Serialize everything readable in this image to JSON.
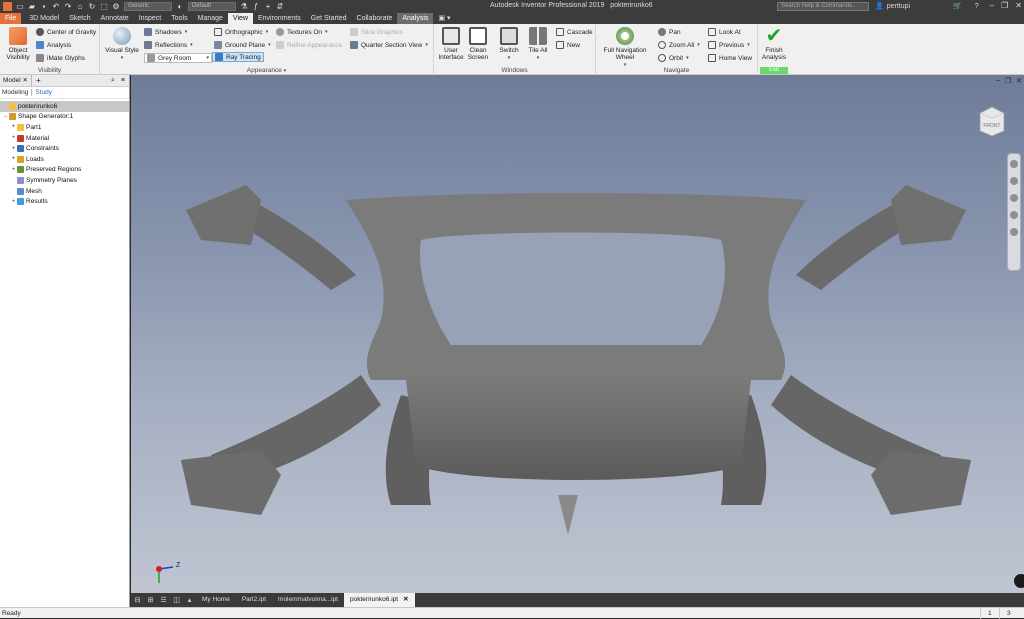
{
  "window": {
    "title": "Autodesk Inventor Professional 2019",
    "document": "pokterirunko6",
    "material_combo": "Generic",
    "appearance_combo": "Default",
    "help_search_placeholder": "Search Help & Commands...",
    "user": "perttupi"
  },
  "ribbon_tabs": [
    "File",
    "3D Model",
    "Sketch",
    "Annotate",
    "Inspect",
    "Tools",
    "Manage",
    "View",
    "Environments",
    "Get Started",
    "Collaborate",
    "Analysis"
  ],
  "active_tab": "View",
  "ribbon": {
    "visibility": {
      "label": "Visibility",
      "object_visibility": "Object Visibility",
      "center_of_gravity": "Center of Gravity",
      "analysis": "Analysis",
      "imate_glyphs": "iMate Glyphs"
    },
    "appearance": {
      "label": "Appearance",
      "visual_style": "Visual Style",
      "shadows": "Shadows",
      "reflections": "Reflections",
      "grey_room": "Grey Room",
      "orthographic": "Orthographic",
      "ground_plane": "Ground Plane",
      "ray_tracing": "Ray Tracing",
      "textures_on": "Textures On",
      "refine_appearance": "Refine Appearance",
      "slice_graphics": "Slice Graphics",
      "quarter_section_view": "Quarter Section View"
    },
    "windows": {
      "label": "Windows",
      "user_interface": "User Interface",
      "clean_screen": "Clean Screen",
      "switch": "Switch",
      "tile_all": "Tile All",
      "cascade": "Cascade",
      "new": "New"
    },
    "navigate": {
      "label": "Navigate",
      "full_navigation_wheel": "Full Navigation Wheel",
      "pan": "Pan",
      "zoom_all": "Zoom All",
      "orbit": "Orbit",
      "look_at": "Look At",
      "previous": "Previous",
      "home_view": "Home View"
    },
    "exit": {
      "label": "Exit",
      "finish_analysis": "Finish Analysis"
    }
  },
  "browser": {
    "tab": "Model",
    "modes": [
      "Modeling",
      "Study"
    ],
    "tree": [
      {
        "label": "pokterirunko6",
        "level": 0,
        "expander": "",
        "icon_color": "#f0c040",
        "selected": true
      },
      {
        "label": "Shape Generator:1",
        "level": 0,
        "expander": "−",
        "icon_color": "#d49a2a",
        "selected": false
      },
      {
        "label": "Part1",
        "level": 1,
        "expander": "+",
        "icon_color": "#f0c040",
        "selected": false
      },
      {
        "label": "Material",
        "level": 1,
        "expander": "+",
        "icon_color": "#c8382a",
        "selected": false
      },
      {
        "label": "Constraints",
        "level": 1,
        "expander": "+",
        "icon_color": "#3b6fb6",
        "selected": false
      },
      {
        "label": "Loads",
        "level": 1,
        "expander": "+",
        "icon_color": "#e0a020",
        "selected": false
      },
      {
        "label": "Preserved Regions",
        "level": 1,
        "expander": "+",
        "icon_color": "#6a8f3a",
        "selected": false
      },
      {
        "label": "Symmetry Planes",
        "level": 1,
        "expander": "",
        "icon_color": "#8c8cd0",
        "selected": false
      },
      {
        "label": "Mesh",
        "level": 1,
        "expander": "",
        "icon_color": "#5a8ac8",
        "selected": false
      },
      {
        "label": "Results",
        "level": 1,
        "expander": "+",
        "icon_color": "#3aa0d8",
        "selected": false
      }
    ]
  },
  "viewport": {
    "viewcube_label": "FRONT",
    "triad_z": "Z"
  },
  "document_tabs": [
    "My Home",
    "Part2.ipt",
    "molemmatvoima...ipt",
    "pokterirunko6.ipt"
  ],
  "active_document": "pokterirunko6.ipt",
  "status": {
    "text": "Ready",
    "count1": "1",
    "count2": "3"
  }
}
